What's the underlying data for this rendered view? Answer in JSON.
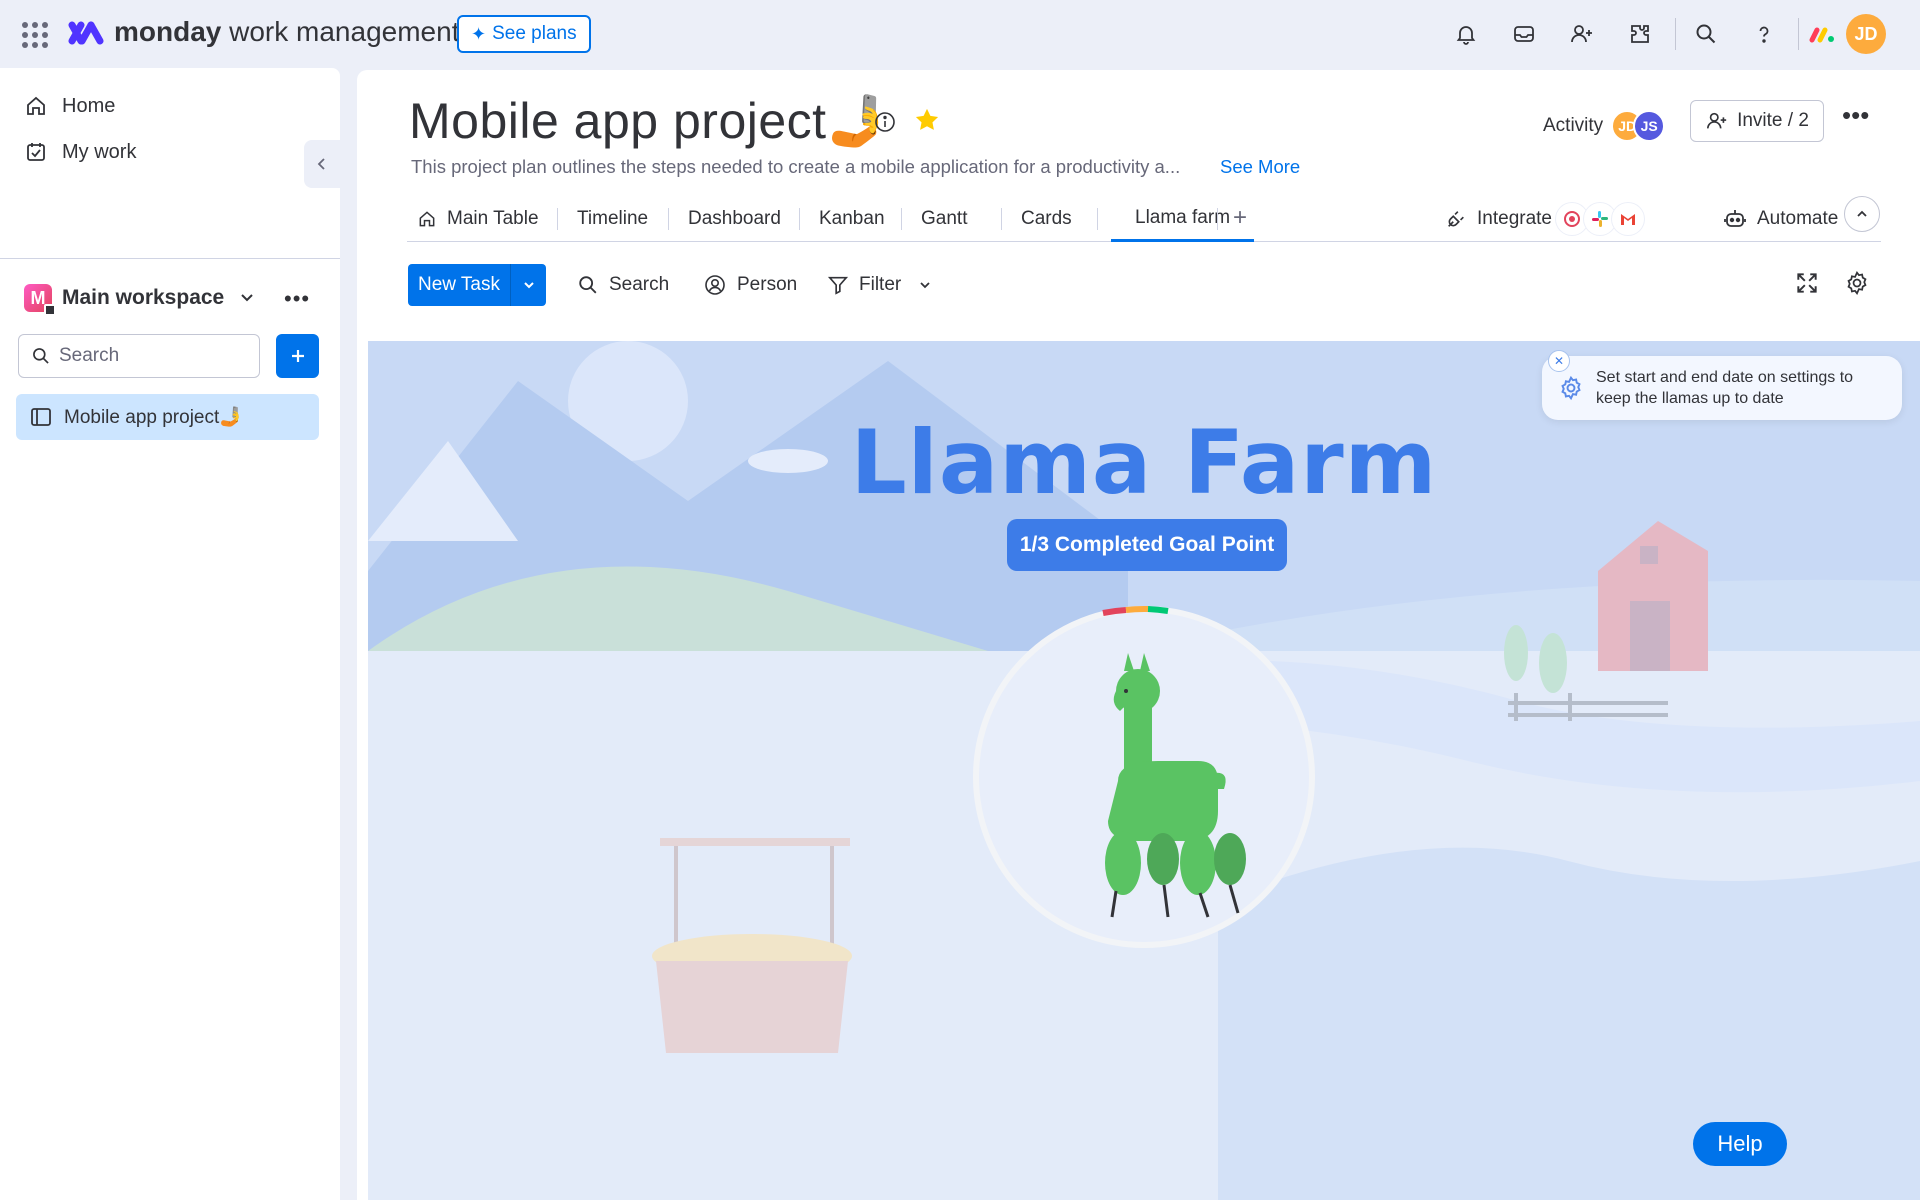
{
  "topbar": {
    "brand_bold": "monday",
    "brand_rest": " work management",
    "see_plans_label": "See plans",
    "user_initials": "JD"
  },
  "sidebar": {
    "home_label": "Home",
    "my_work_label": "My work",
    "workspace_initial": "M",
    "workspace_name": "Main workspace",
    "search_placeholder": "Search",
    "boards": [
      {
        "label": "Mobile app project🤳"
      }
    ]
  },
  "board": {
    "title": "Mobile app project🤳",
    "description": "This project plan outlines the steps needed to create a mobile application for a productivity a...",
    "see_more_label": "See More",
    "activity_label": "Activity",
    "activity_avatars": [
      {
        "initials": "JD",
        "color": "#fdab3d"
      },
      {
        "initials": "JS",
        "color": "#5559df"
      }
    ],
    "invite_label": "Invite / 2"
  },
  "tabs": [
    {
      "label": "Main Table"
    },
    {
      "label": "Timeline"
    },
    {
      "label": "Dashboard"
    },
    {
      "label": "Kanban"
    },
    {
      "label": "Gantt"
    },
    {
      "label": "Cards"
    },
    {
      "label": "Llama farm"
    }
  ],
  "active_tab": "Llama farm",
  "integrate_label": "Integrate",
  "automate_label": "Automate",
  "toolbar": {
    "new_task_label": "New Task",
    "search_label": "Search",
    "person_label": "Person",
    "filter_label": "Filter"
  },
  "llama_farm": {
    "title": "Llama Farm",
    "goal_label": "1/3 Completed Goal Point",
    "hint_text": "Set start and end date on settings to keep the llamas up to date"
  },
  "help_label": "Help",
  "colors": {
    "primary": "#0073ea",
    "farm_title": "#3d7ce8",
    "llama": "#5ac363",
    "selected_board_bg": "#cce5ff"
  }
}
